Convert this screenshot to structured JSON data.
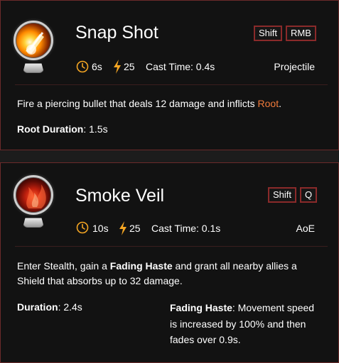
{
  "abilities": [
    {
      "name": "Snap Shot",
      "keys": [
        "Shift",
        "RMB"
      ],
      "cooldown": "6s",
      "energy": "25",
      "cast_time": "Cast Time: 0.4s",
      "tag": "Projectile",
      "description": {
        "before": "Fire a piercing bullet that deals 12 damage and inflicts ",
        "highlight": "Root",
        "after": "."
      },
      "detail": {
        "label": "Root Duration",
        "value": ": 1.5s"
      }
    },
    {
      "name": "Smoke Veil",
      "keys": [
        "Shift",
        "Q"
      ],
      "cooldown": "10s",
      "energy": "25",
      "cast_time": "Cast Time: 0.1s",
      "tag": "AoE",
      "description": {
        "before": "Enter Stealth, gain a ",
        "bold": "Fading Haste",
        "after": " and grant all nearby allies a Shield that absorbs up to 32 damage."
      },
      "detail": {
        "label": "Duration",
        "value": ": 2.4s"
      },
      "effect": {
        "label": "Fading Haste",
        "value": ": Movement speed is increased by 100% and then fades over 0.9s."
      }
    }
  ],
  "colors": {
    "accent": "#f07a3a",
    "border": "#6b2a2a",
    "icon_gold": "#f5a623"
  },
  "icons": [
    "clock-icon",
    "lightning-icon"
  ]
}
